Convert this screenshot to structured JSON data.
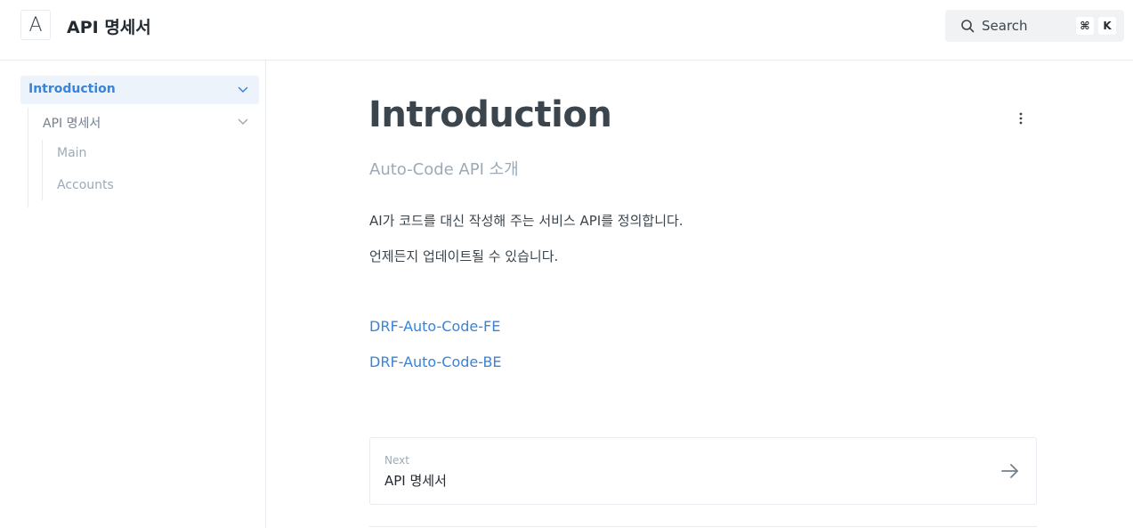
{
  "header": {
    "logo_letter": "A",
    "site_title": "API 명세서",
    "search": {
      "label": "Search",
      "shortcut_modifier": "⌘",
      "shortcut_key": "K",
      "icon": "search-icon"
    }
  },
  "sidebar": {
    "items": [
      {
        "label": "Introduction",
        "active": true,
        "expanded": true,
        "icon": "chevron-down-icon"
      },
      {
        "label": "API 명세서",
        "active": false,
        "expanded": true,
        "icon": "chevron-down-icon"
      },
      {
        "label": "Main",
        "active": false
      },
      {
        "label": "Accounts",
        "active": false
      }
    ]
  },
  "main": {
    "title": "Introduction",
    "subtitle": "Auto-Code API 소개",
    "paragraphs": [
      "AI가 코드를 대신 작성해 주는 서비스 API를 정의합니다.",
      "언제든지 업데이트될 수 있습니다."
    ],
    "links": [
      "DRF-Auto-Code-FE",
      "DRF-Auto-Code-BE"
    ],
    "more_icon": "more-vertical-icon",
    "next": {
      "caption": "Next",
      "title": "API 명세서",
      "icon": "arrow-right-icon"
    }
  },
  "colors": {
    "accent": "#3884d9",
    "active_bg": "#edf3fb",
    "border": "#e6ecf1",
    "muted_text": "#9daab6"
  }
}
